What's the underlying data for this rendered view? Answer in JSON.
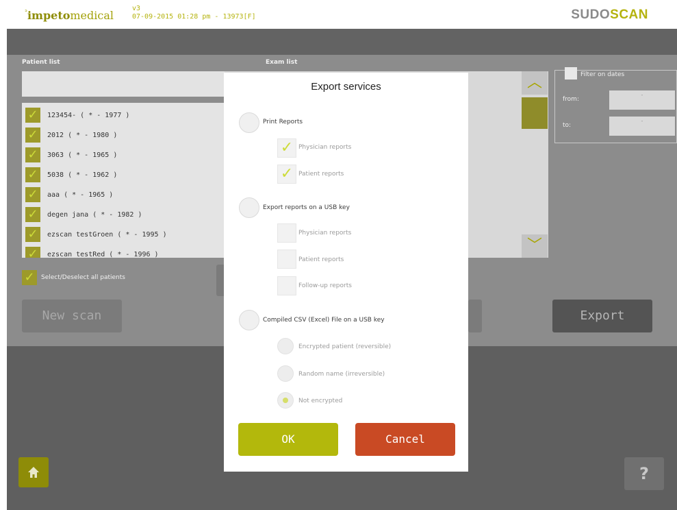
{
  "header": {
    "logo_prefix": "impeto",
    "logo_suffix": "medical",
    "version": "v3",
    "datetime_line": "07-09-2015 01:28 pm - 13973[F]",
    "brand_left": "SUDO",
    "brand_right": "SCAN"
  },
  "panel": {
    "patient_list_label": "Patient list",
    "exam_list_label": "Exam list",
    "patients": [
      "123454- ( * - 1977 )",
      "2012 ( * - 1980 )",
      "3063 ( * - 1965 )",
      "5038 ( * - 1962 )",
      "aaa ( * - 1965 )",
      "degen jana ( * - 1982 )",
      "ezscan testGroen ( * - 1995 )",
      "ezscan testRed ( * - 1996 )"
    ],
    "select_all_label": "Select/Deselect all patients",
    "filter_label": "Filter on dates",
    "from_label": "from:",
    "to_label": "to:",
    "date_placeholder": "-",
    "new_scan_label": "New scan",
    "export_label": "Export",
    "help_label": "?"
  },
  "modal": {
    "title": "Export services",
    "options": {
      "print_reports": "Print Reports",
      "export_usb": "Export reports on a USB key",
      "compiled_csv": "Compiled CSV (Excel) File on a USB key"
    },
    "print_sub": [
      "Physician reports",
      "Patient reports"
    ],
    "usb_sub": [
      "Physician reports",
      "Patient reports",
      "Follow-up reports"
    ],
    "csv_sub": [
      "Encrypted patient (reversible)",
      "Random name (irreversible)",
      "Not encrypted"
    ],
    "ok_label": "OK",
    "cancel_label": "Cancel"
  },
  "colors": {
    "accent_olive": "#b3b80c",
    "cancel_red": "#c94a24"
  }
}
